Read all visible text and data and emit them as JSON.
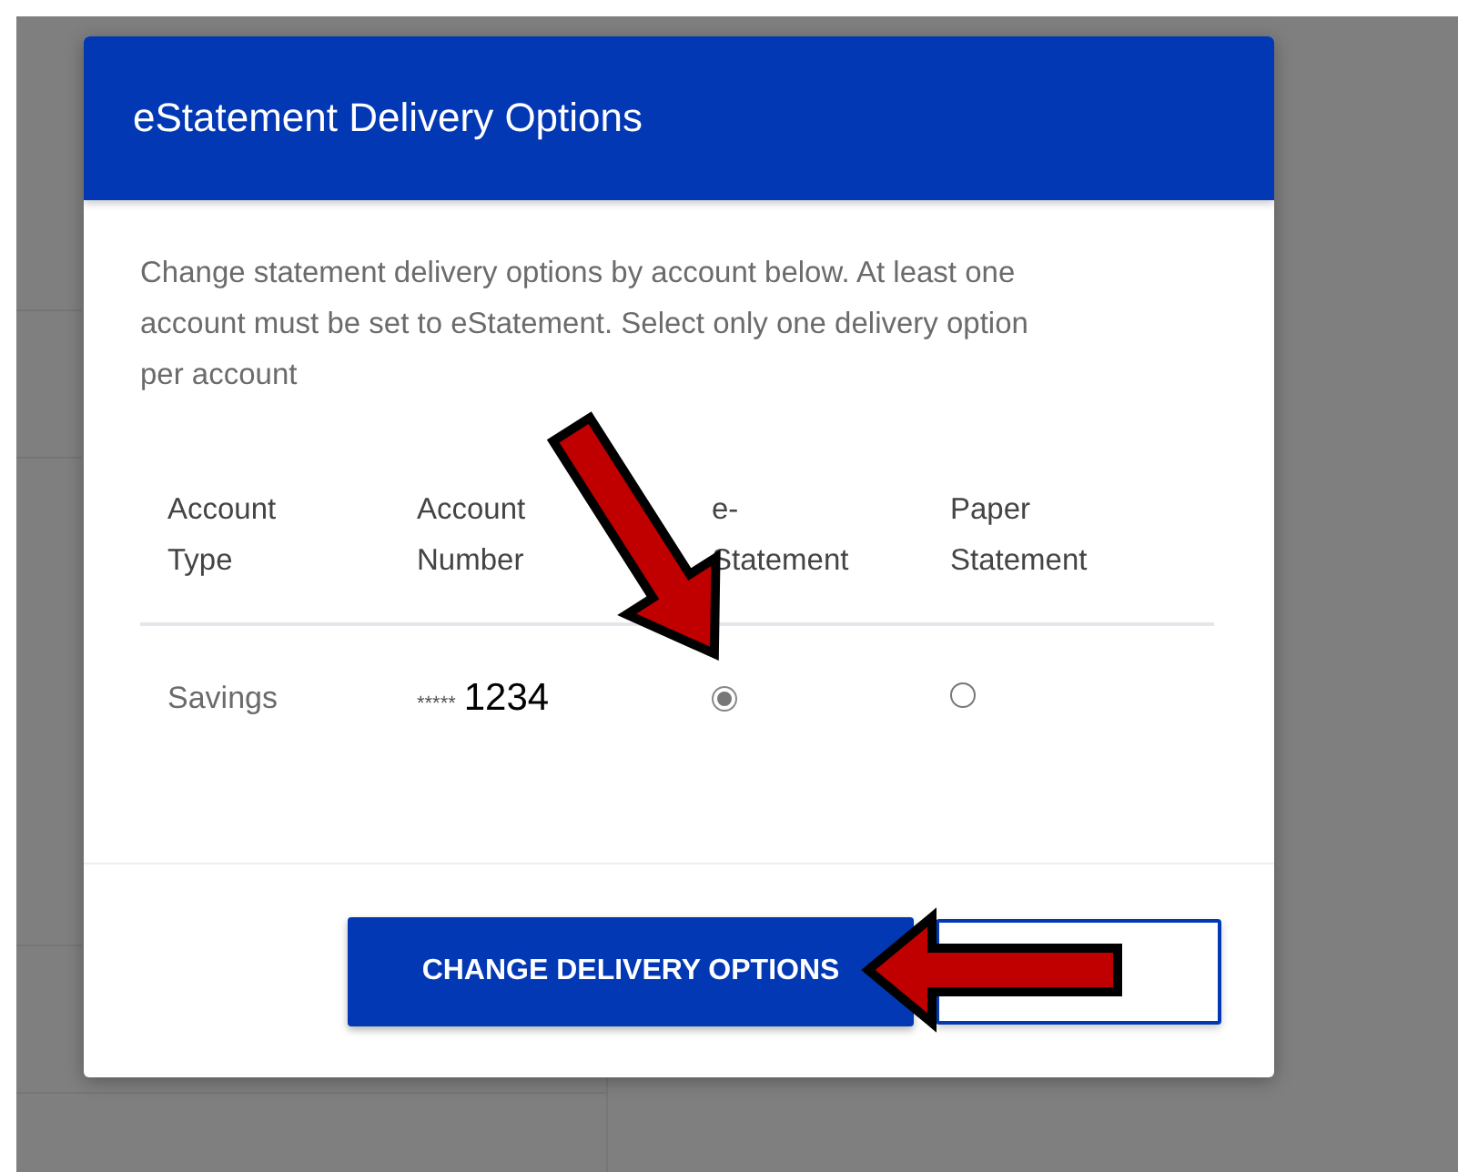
{
  "dialog": {
    "title": "eStatement Delivery Options",
    "description": "Change statement delivery options by account below. At least one account must be set to eStatement. Select only one delivery option per account",
    "table": {
      "columns": [
        "Account Type",
        "Account Number",
        "e-Statement",
        "Paper Statement"
      ],
      "rows": [
        {
          "account_type": "Savings",
          "account_mask": "*****",
          "account_number": "1234",
          "options": [
            {
              "selected": true
            },
            {
              "selected": false
            }
          ]
        }
      ]
    },
    "buttons": [
      {
        "kind": "primary",
        "label": "CHANGE DELIVERY OPTIONS"
      },
      {
        "kind": "outlined"
      }
    ]
  }
}
